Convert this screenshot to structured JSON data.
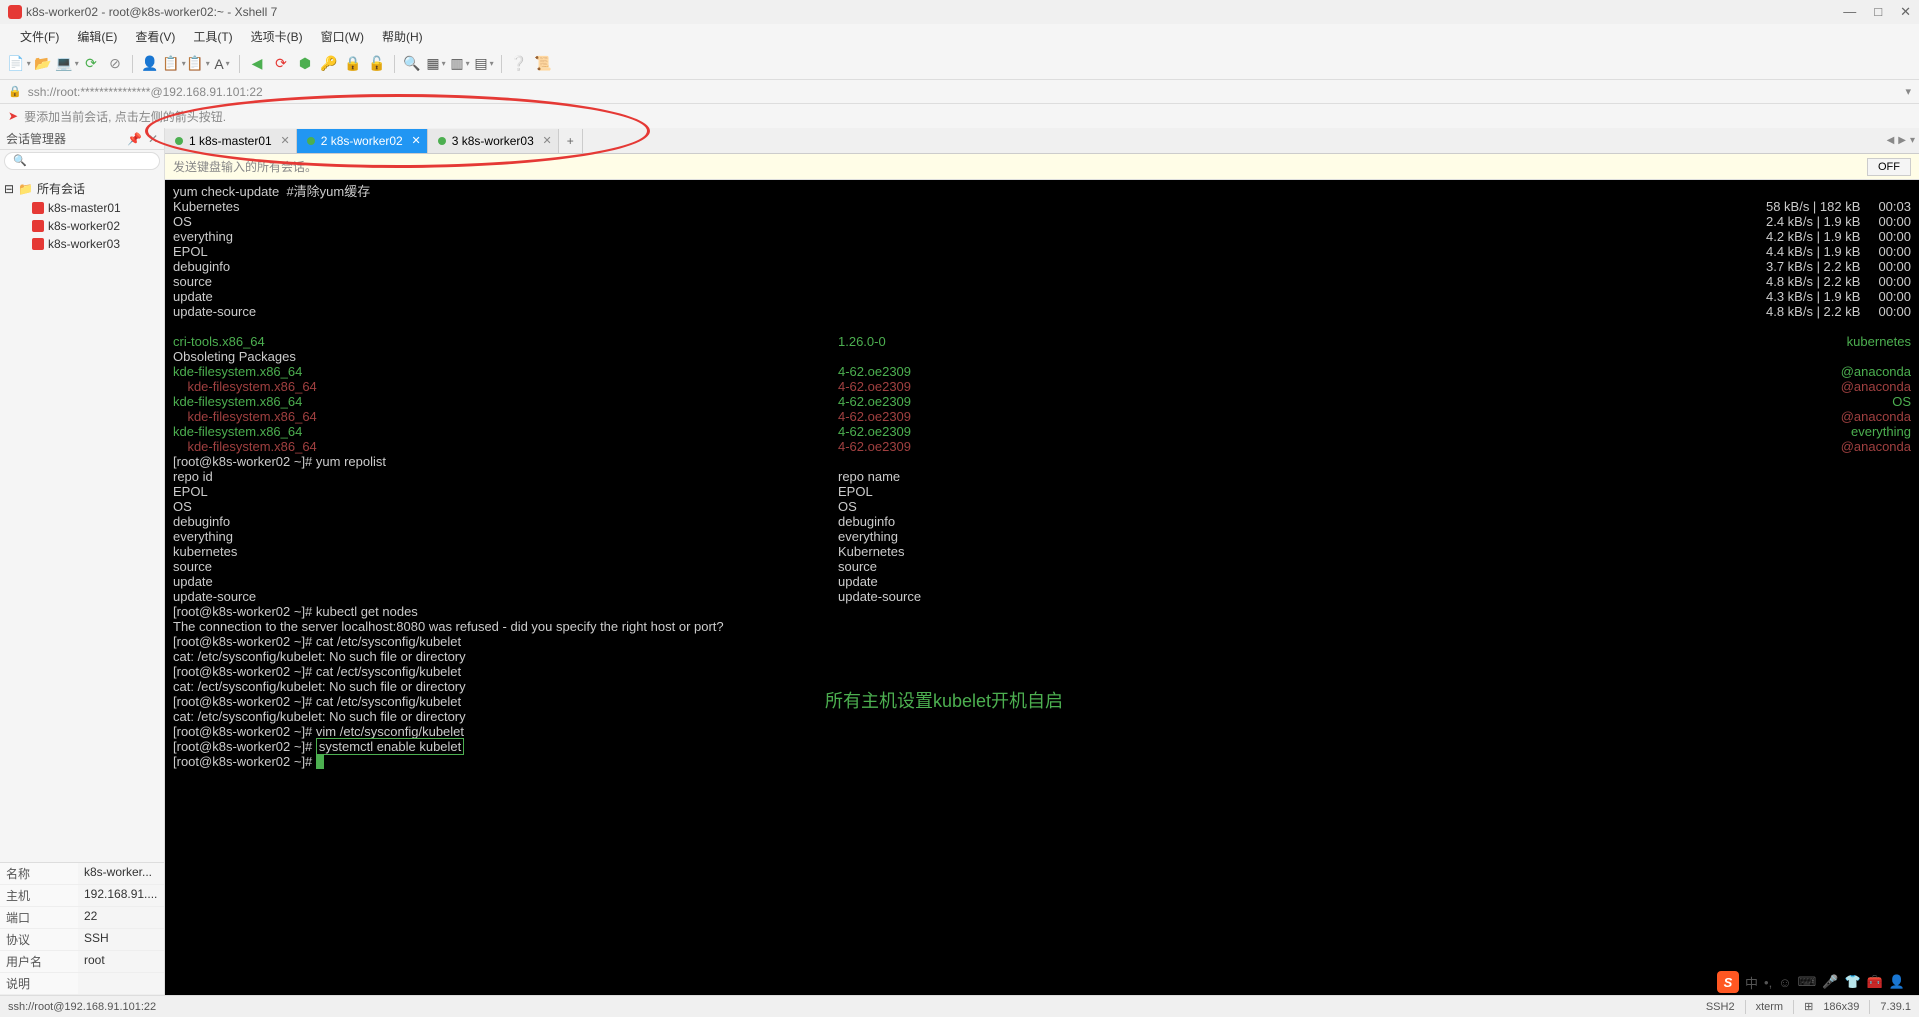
{
  "title": "k8s-worker02 - root@k8s-worker02:~ - Xshell 7",
  "menu": [
    "文件(F)",
    "编辑(E)",
    "查看(V)",
    "工具(T)",
    "选项卡(B)",
    "窗口(W)",
    "帮助(H)"
  ],
  "addr": "ssh://root:***************@192.168.91.101:22",
  "hint": "要添加当前会话, 点击左侧的箭头按钮.",
  "session_manager_title": "会话管理器",
  "tree_root": "所有会话",
  "tree_items": [
    "k8s-master01",
    "k8s-worker02",
    "k8s-worker03"
  ],
  "props": [
    {
      "label": "名称",
      "value": "k8s-worker..."
    },
    {
      "label": "主机",
      "value": "192.168.91...."
    },
    {
      "label": "端口",
      "value": "22"
    },
    {
      "label": "协议",
      "value": "SSH"
    },
    {
      "label": "用户名",
      "value": "root"
    },
    {
      "label": "说明",
      "value": ""
    }
  ],
  "tabs": [
    {
      "label": "1 k8s-master01",
      "active": false
    },
    {
      "label": "2 k8s-worker02",
      "active": true
    },
    {
      "label": "3 k8s-worker03",
      "active": false
    }
  ],
  "send_bar_text": "发送键盘输入的所有会话。",
  "off_label": "OFF",
  "terminal": {
    "annotation": "所有主机设置kubelet开机自启",
    "line1": "yum check-update  #清除yum缓存",
    "repos": [
      {
        "name": "Kubernetes",
        "speed": "58 kB/s | 182 kB     00:03"
      },
      {
        "name": "OS",
        "speed": "2.4 kB/s | 1.9 kB     00:00"
      },
      {
        "name": "everything",
        "speed": "4.2 kB/s | 1.9 kB     00:00"
      },
      {
        "name": "EPOL",
        "speed": "4.4 kB/s | 1.9 kB     00:00"
      },
      {
        "name": "debuginfo",
        "speed": "3.7 kB/s | 2.2 kB     00:00"
      },
      {
        "name": "source",
        "speed": "4.8 kB/s | 2.2 kB     00:00"
      },
      {
        "name": "update",
        "speed": "4.3 kB/s | 1.9 kB     00:00"
      },
      {
        "name": "update-source",
        "speed": "4.8 kB/s | 2.2 kB     00:00"
      }
    ],
    "pkg_cri": {
      "name": "cri-tools.x86_64",
      "ver": "1.26.0-0",
      "src": "kubernetes"
    },
    "obsoleting": "Obsoleting Packages",
    "kde_main": {
      "name": "kde-filesystem.x86_64",
      "ver": "4-62.oe2309",
      "src": "@anaconda"
    },
    "kde_lines": [
      {
        "name": "    kde-filesystem.x86_64",
        "ver": "4-62.oe2309",
        "src": "@anaconda",
        "cls": "t-red"
      },
      {
        "name": "kde-filesystem.x86_64",
        "ver": "4-62.oe2309",
        "src": "OS",
        "cls": "t-green"
      },
      {
        "name": "    kde-filesystem.x86_64",
        "ver": "4-62.oe2309",
        "src": "@anaconda",
        "cls": "t-red"
      },
      {
        "name": "kde-filesystem.x86_64",
        "ver": "4-62.oe2309",
        "src": "everything",
        "cls": "t-green"
      },
      {
        "name": "    kde-filesystem.x86_64",
        "ver": "4-62.oe2309",
        "src": "@anaconda",
        "cls": "t-red"
      }
    ],
    "prompt_repolist": "[root@k8s-worker02 ~]# yum repolist",
    "repolist_header": {
      "c1": "repo id",
      "c2": "repo name"
    },
    "repolist": [
      {
        "c1": "EPOL",
        "c2": "EPOL"
      },
      {
        "c1": "OS",
        "c2": "OS"
      },
      {
        "c1": "debuginfo",
        "c2": "debuginfo"
      },
      {
        "c1": "everything",
        "c2": "everything"
      },
      {
        "c1": "kubernetes",
        "c2": "Kubernetes"
      },
      {
        "c1": "source",
        "c2": "source"
      },
      {
        "c1": "update",
        "c2": "update"
      },
      {
        "c1": "update-source",
        "c2": "update-source"
      }
    ],
    "cmds": [
      "[root@k8s-worker02 ~]# kubectl get nodes",
      "The connection to the server localhost:8080 was refused - did you specify the right host or port?",
      "[root@k8s-worker02 ~]# cat /etc/sysconfig/kubelet",
      "cat: /etc/sysconfig/kubelet: No such file or directory",
      "[root@k8s-worker02 ~]# cat /ect/sysconfig/kubelet",
      "cat: /ect/sysconfig/kubelet: No such file or directory",
      "[root@k8s-worker02 ~]# cat /etc/sysconfig/kubelet",
      "cat: /etc/sysconfig/kubelet: No such file or directory",
      "[root@k8s-worker02 ~]# vim /etc/sysconfig/kubelet"
    ],
    "boxed_prompt": "[root@k8s-worker02 ~]# ",
    "boxed_cmd": "systemctl enable kubelet",
    "last_prompt": "[root@k8s-worker02 ~]# "
  },
  "status": {
    "left": "ssh://root@192.168.91.101:22",
    "ssh": "SSH2",
    "term": "xterm",
    "size": "186x39",
    "misc": "7.39.1"
  }
}
